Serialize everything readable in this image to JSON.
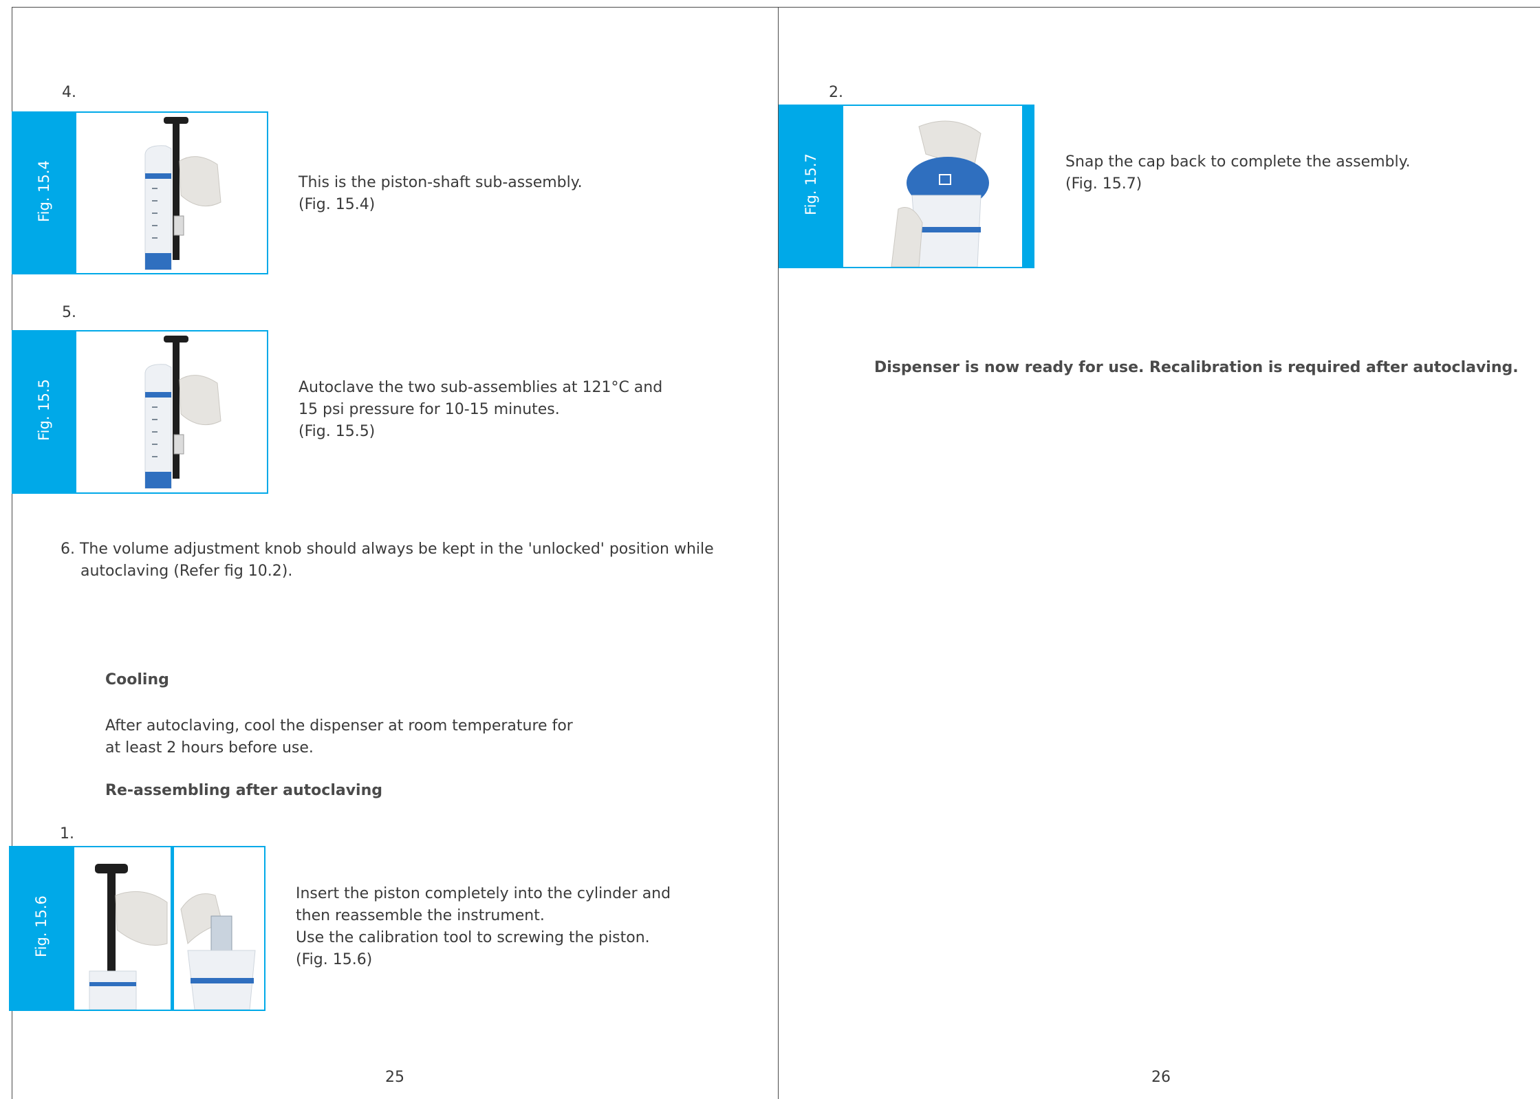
{
  "left_page": {
    "step4": {
      "number": "4.",
      "fig_label": "Fig. 15.4",
      "text": [
        "This is the piston-shaft sub-assembly.",
        "(Fig. 15.4)"
      ]
    },
    "step5": {
      "number": "5.",
      "fig_label": "Fig. 15.5",
      "text": [
        "Autoclave the two sub-assemblies at 121°C and",
        "15 psi pressure for 10-15 minutes.",
        "(Fig. 15.5)"
      ]
    },
    "step6": [
      "6. The volume adjustment knob should always be kept in the 'unlocked' position while",
      "autoclaving (Refer fig 10.2)."
    ],
    "cooling": {
      "heading": "Cooling",
      "text": [
        "After autoclaving, cool the dispenser at room temperature for",
        "at least 2 hours before use."
      ]
    },
    "reassembling": {
      "heading": "Re-assembling after autoclaving"
    },
    "step1": {
      "number": "1.",
      "fig_label": "Fig. 15.6",
      "text": [
        "Insert the piston completely into the cylinder and",
        "then reassemble the instrument.",
        "Use the calibration tool to screwing the piston.",
        "(Fig. 15.6)"
      ]
    },
    "page_number": "25"
  },
  "right_page": {
    "step2": {
      "number": "2.",
      "fig_label": "Fig. 15.7",
      "text": [
        "Snap the cap back to complete the assembly.",
        "(Fig. 15.7)"
      ]
    },
    "note": "Dispenser is now ready for use. Recalibration is required after autoclaving.",
    "page_number": "26"
  },
  "colors": {
    "accent": "#00a9e8",
    "text": "#3a3a3a",
    "rule": "#4a4a4a"
  }
}
